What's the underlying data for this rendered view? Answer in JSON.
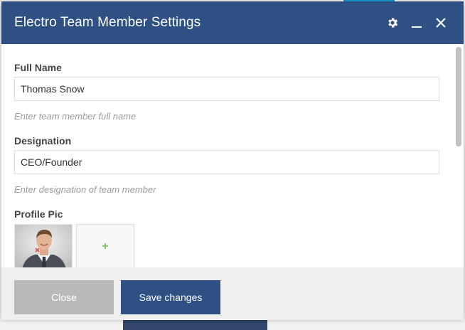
{
  "modal": {
    "title": "Electro Team Member Settings",
    "header_icons": [
      "gear-icon",
      "minimize-icon",
      "close-icon"
    ]
  },
  "fields": {
    "full_name": {
      "label": "Full Name",
      "value": "Thomas Snow",
      "hint": "Enter team member full name"
    },
    "designation": {
      "label": "Designation",
      "value": "CEO/Founder",
      "hint": "Enter designation of team member"
    },
    "profile_pic": {
      "label": "Profile Pic",
      "add_symbol": "+"
    }
  },
  "footer": {
    "close_label": "Close",
    "save_label": "Save changes"
  },
  "colors": {
    "header": "#2f5083",
    "save_button": "#2f5083",
    "close_button": "#b9b9b9",
    "add_plus": "#7cc35b"
  }
}
